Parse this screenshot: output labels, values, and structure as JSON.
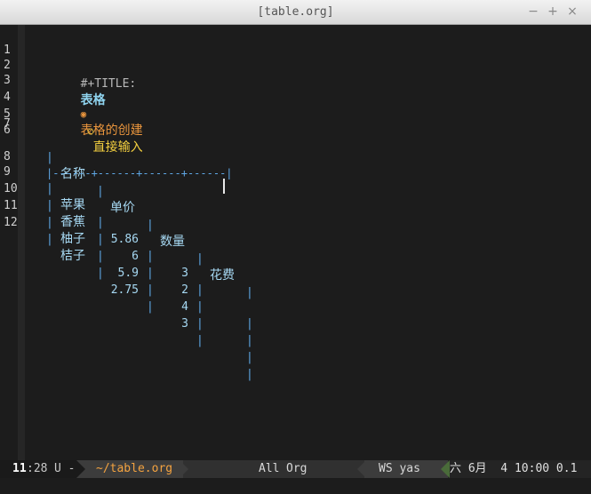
{
  "window": {
    "title": "[table.org]",
    "minimize": "−",
    "maximize": "+",
    "close": "×"
  },
  "line_numbers": [
    "1",
    "2",
    "3",
    "4",
    "5",
    "6",
    "7",
    "8",
    "9",
    "10",
    "11",
    "12"
  ],
  "buffer": {
    "title_keyword": "#+TITLE:",
    "title_value": "表格",
    "heading1_bullet": "◉",
    "heading1": "表格的创建",
    "heading2_bullet": "○",
    "heading2": "直接输入",
    "table": {
      "header": [
        "名称",
        "单价",
        "数量",
        "花费"
      ],
      "separator": "|------+------+------+------|",
      "rows": [
        [
          "苹果",
          "5.86",
          "3",
          ""
        ],
        [
          "香蕉",
          "6",
          "2",
          ""
        ],
        [
          "柚子",
          "5.9",
          "4",
          ""
        ],
        [
          "桔子",
          "2.75",
          "3",
          ""
        ]
      ]
    }
  },
  "modeline": {
    "line": "11",
    "col": ":28",
    "encoding": "U -",
    "file": "~/table.org",
    "position": "All",
    "mode": "Org",
    "minor_modes": "WS yas",
    "datetime": "六 6月  4 10:00 0.1"
  },
  "colors": {
    "background": "#1c1c1c",
    "title": "#8fd3ee",
    "heading1": "#e9953d",
    "heading2": "#f4d03f",
    "table_border": "#5fa8e6",
    "table_text": "#a6d8f2",
    "modeline_file": "#f4a340"
  }
}
